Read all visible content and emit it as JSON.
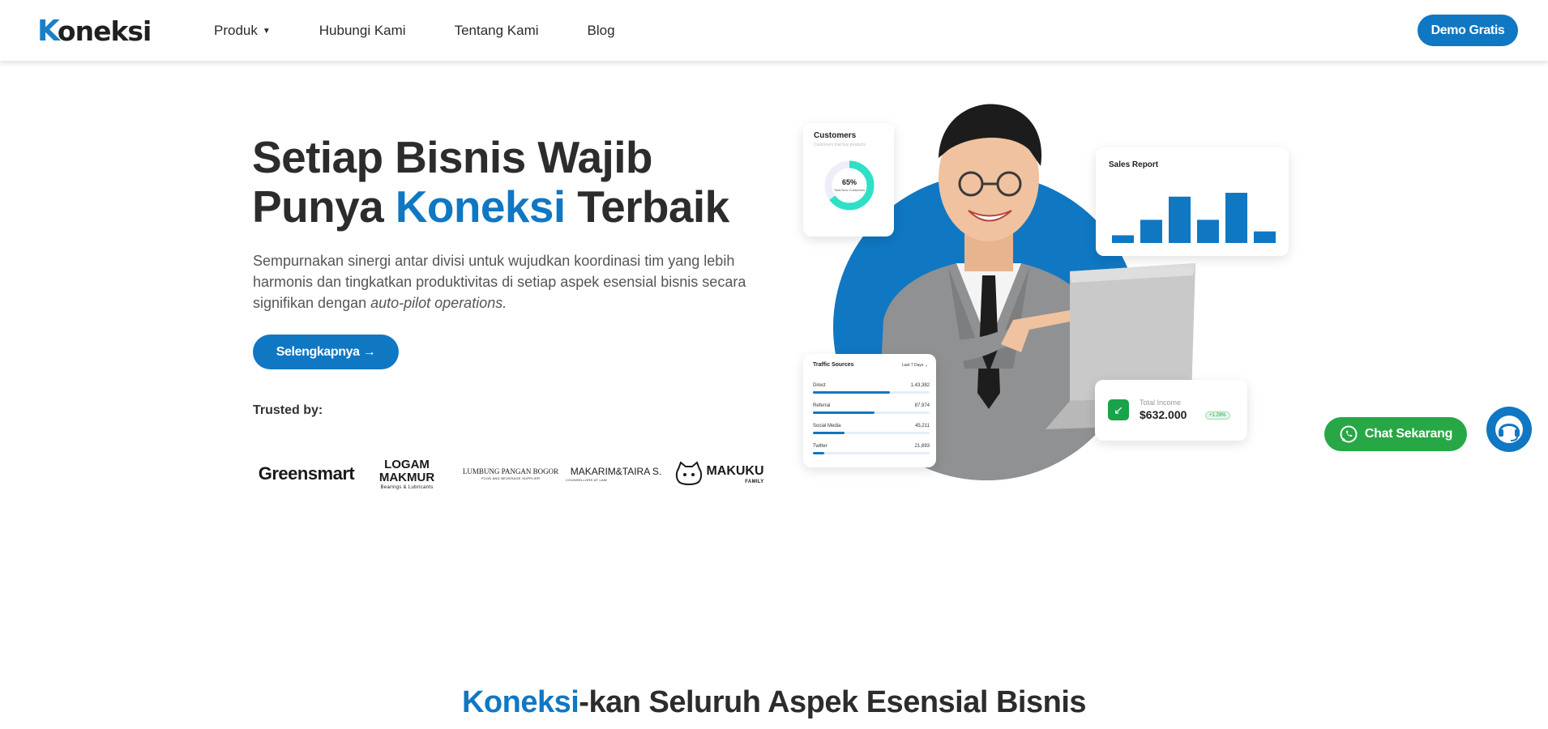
{
  "brand": {
    "logo_text": "Koneksi",
    "accent": "#1077c3"
  },
  "nav": {
    "items": [
      {
        "label": "Produk",
        "has_dropdown": true
      },
      {
        "label": "Hubungi Kami"
      },
      {
        "label": "Tentang Kami"
      },
      {
        "label": "Blog"
      }
    ],
    "cta_label": "Demo Gratis"
  },
  "hero": {
    "title_line1": "Setiap Bisnis Wajib",
    "title_line2_pre": "Punya ",
    "title_line2_accent": "Koneksi",
    "title_line2_post": " Terbaik",
    "description": "Sempurnakan sinergi antar divisi untuk wujudkan koordinasi tim yang lebih harmonis dan tingkatkan produktivitas di setiap aspek esensial bisnis secara signifikan dengan ",
    "description_em": "auto-pilot operations.",
    "cta_label": "Selengkapnya →",
    "trusted_label": "Trusted by:",
    "trusted_logos": [
      {
        "name": "Greensmart"
      },
      {
        "name": "LOGAM MAKMUR",
        "sub": "Bearings & Lubricants"
      },
      {
        "name": "LUMBUNG PANGAN BOGOR",
        "sub": "FOOD AND BEVERAGE SUPPLIER"
      },
      {
        "name": "MAKARIM&TAIRA S.",
        "sub": "COUNSELLORS AT LAW"
      },
      {
        "name": "MAKUKU",
        "sub": "FAMILY"
      }
    ]
  },
  "dashboard": {
    "customers": {
      "title": "Customers",
      "subtitle": "Customers that buy products",
      "percent": 65,
      "percent_label": "65%",
      "center_sub": "Total New Customers"
    },
    "sales_report": {
      "title": "Sales Report",
      "values": [
        8,
        24,
        48,
        24,
        52,
        12
      ]
    },
    "traffic": {
      "title": "Traffic Sources",
      "range": "Last 7 Days",
      "rows": [
        {
          "label": "Direct",
          "value": "1,43,382",
          "fraction": 0.66
        },
        {
          "label": "Referral",
          "value": "87,974",
          "fraction": 0.53
        },
        {
          "label": "Social Media",
          "value": "45,211",
          "fraction": 0.27
        },
        {
          "label": "Twitter",
          "value": "21,893",
          "fraction": 0.1
        }
      ]
    },
    "income": {
      "label": "Total Income",
      "value": "$632.000",
      "badge": "+1.29%"
    }
  },
  "floating": {
    "chat_label": "Chat Sekarang",
    "chat_color": "#27a745"
  },
  "section": {
    "title_accent": "Koneksi",
    "title_rest": "-kan Seluruh Aspek Esensial Bisnis"
  }
}
